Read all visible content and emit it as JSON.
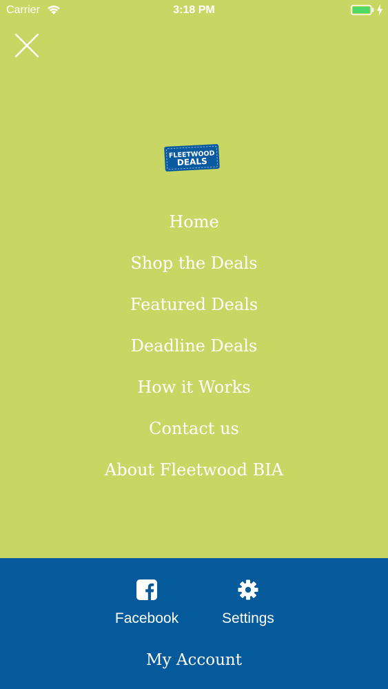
{
  "status_bar": {
    "carrier": "Carrier",
    "time": "3:18 PM",
    "icons": [
      "wifi-icon",
      "battery-icon",
      "charging-icon"
    ],
    "battery_color": "#4cd964"
  },
  "close": {
    "icon": "close-icon"
  },
  "logo": {
    "line1": "FLEETWOOD",
    "line2": "DEALS",
    "color": "#0a5aa0"
  },
  "menu": {
    "items": [
      {
        "label": "Home"
      },
      {
        "label": "Shop the Deals"
      },
      {
        "label": "Featured Deals"
      },
      {
        "label": "Deadline Deals"
      },
      {
        "label": "How it Works"
      },
      {
        "label": "Contact us"
      },
      {
        "label": "About Fleetwood BIA"
      }
    ]
  },
  "footer": {
    "facebook": {
      "label": "Facebook",
      "icon": "facebook-icon"
    },
    "settings": {
      "label": "Settings",
      "icon": "gear-icon"
    },
    "my_account": "My Account"
  },
  "colors": {
    "background": "#c8d664",
    "footer": "#055a9b",
    "text": "#ffffff"
  }
}
